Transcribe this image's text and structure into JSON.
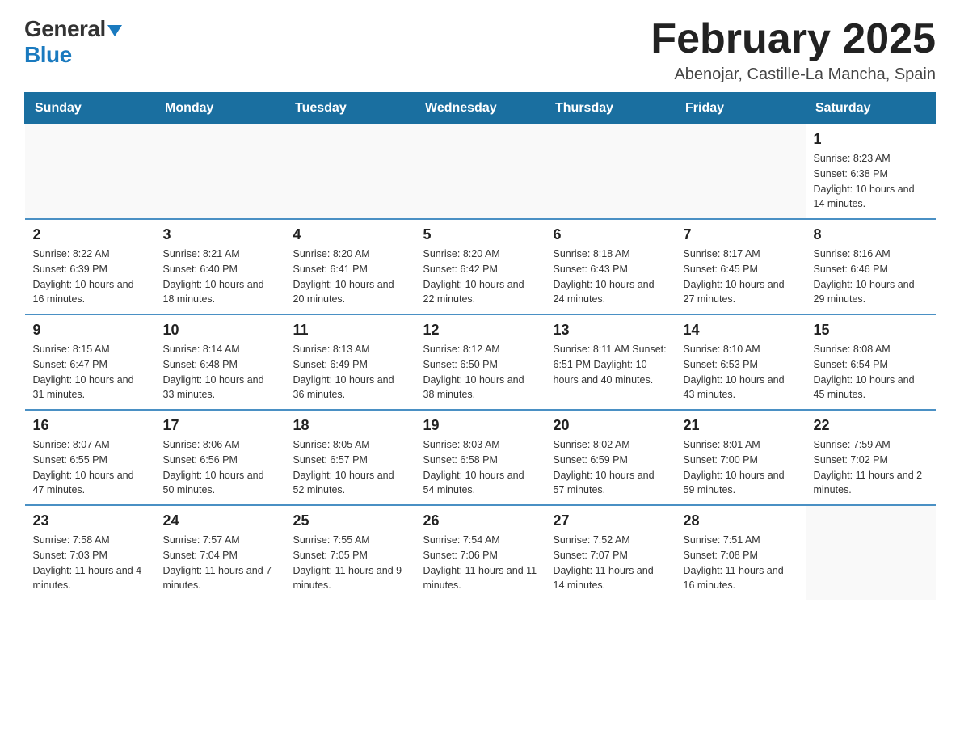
{
  "header": {
    "logo_general": "General",
    "logo_blue": "Blue",
    "title": "February 2025",
    "subtitle": "Abenojar, Castille-La Mancha, Spain"
  },
  "calendar": {
    "days_of_week": [
      "Sunday",
      "Monday",
      "Tuesday",
      "Wednesday",
      "Thursday",
      "Friday",
      "Saturday"
    ],
    "weeks": [
      [
        {
          "day": "",
          "info": ""
        },
        {
          "day": "",
          "info": ""
        },
        {
          "day": "",
          "info": ""
        },
        {
          "day": "",
          "info": ""
        },
        {
          "day": "",
          "info": ""
        },
        {
          "day": "",
          "info": ""
        },
        {
          "day": "1",
          "info": "Sunrise: 8:23 AM\nSunset: 6:38 PM\nDaylight: 10 hours and 14 minutes."
        }
      ],
      [
        {
          "day": "2",
          "info": "Sunrise: 8:22 AM\nSunset: 6:39 PM\nDaylight: 10 hours and 16 minutes."
        },
        {
          "day": "3",
          "info": "Sunrise: 8:21 AM\nSunset: 6:40 PM\nDaylight: 10 hours and 18 minutes."
        },
        {
          "day": "4",
          "info": "Sunrise: 8:20 AM\nSunset: 6:41 PM\nDaylight: 10 hours and 20 minutes."
        },
        {
          "day": "5",
          "info": "Sunrise: 8:20 AM\nSunset: 6:42 PM\nDaylight: 10 hours and 22 minutes."
        },
        {
          "day": "6",
          "info": "Sunrise: 8:18 AM\nSunset: 6:43 PM\nDaylight: 10 hours and 24 minutes."
        },
        {
          "day": "7",
          "info": "Sunrise: 8:17 AM\nSunset: 6:45 PM\nDaylight: 10 hours and 27 minutes."
        },
        {
          "day": "8",
          "info": "Sunrise: 8:16 AM\nSunset: 6:46 PM\nDaylight: 10 hours and 29 minutes."
        }
      ],
      [
        {
          "day": "9",
          "info": "Sunrise: 8:15 AM\nSunset: 6:47 PM\nDaylight: 10 hours and 31 minutes."
        },
        {
          "day": "10",
          "info": "Sunrise: 8:14 AM\nSunset: 6:48 PM\nDaylight: 10 hours and 33 minutes."
        },
        {
          "day": "11",
          "info": "Sunrise: 8:13 AM\nSunset: 6:49 PM\nDaylight: 10 hours and 36 minutes."
        },
        {
          "day": "12",
          "info": "Sunrise: 8:12 AM\nSunset: 6:50 PM\nDaylight: 10 hours and 38 minutes."
        },
        {
          "day": "13",
          "info": "Sunrise: 8:11 AM\nSunset: 6:51 PM\nDaylight: 10 hours and 40 minutes."
        },
        {
          "day": "14",
          "info": "Sunrise: 8:10 AM\nSunset: 6:53 PM\nDaylight: 10 hours and 43 minutes."
        },
        {
          "day": "15",
          "info": "Sunrise: 8:08 AM\nSunset: 6:54 PM\nDaylight: 10 hours and 45 minutes."
        }
      ],
      [
        {
          "day": "16",
          "info": "Sunrise: 8:07 AM\nSunset: 6:55 PM\nDaylight: 10 hours and 47 minutes."
        },
        {
          "day": "17",
          "info": "Sunrise: 8:06 AM\nSunset: 6:56 PM\nDaylight: 10 hours and 50 minutes."
        },
        {
          "day": "18",
          "info": "Sunrise: 8:05 AM\nSunset: 6:57 PM\nDaylight: 10 hours and 52 minutes."
        },
        {
          "day": "19",
          "info": "Sunrise: 8:03 AM\nSunset: 6:58 PM\nDaylight: 10 hours and 54 minutes."
        },
        {
          "day": "20",
          "info": "Sunrise: 8:02 AM\nSunset: 6:59 PM\nDaylight: 10 hours and 57 minutes."
        },
        {
          "day": "21",
          "info": "Sunrise: 8:01 AM\nSunset: 7:00 PM\nDaylight: 10 hours and 59 minutes."
        },
        {
          "day": "22",
          "info": "Sunrise: 7:59 AM\nSunset: 7:02 PM\nDaylight: 11 hours and 2 minutes."
        }
      ],
      [
        {
          "day": "23",
          "info": "Sunrise: 7:58 AM\nSunset: 7:03 PM\nDaylight: 11 hours and 4 minutes."
        },
        {
          "day": "24",
          "info": "Sunrise: 7:57 AM\nSunset: 7:04 PM\nDaylight: 11 hours and 7 minutes."
        },
        {
          "day": "25",
          "info": "Sunrise: 7:55 AM\nSunset: 7:05 PM\nDaylight: 11 hours and 9 minutes."
        },
        {
          "day": "26",
          "info": "Sunrise: 7:54 AM\nSunset: 7:06 PM\nDaylight: 11 hours and 11 minutes."
        },
        {
          "day": "27",
          "info": "Sunrise: 7:52 AM\nSunset: 7:07 PM\nDaylight: 11 hours and 14 minutes."
        },
        {
          "day": "28",
          "info": "Sunrise: 7:51 AM\nSunset: 7:08 PM\nDaylight: 11 hours and 16 minutes."
        },
        {
          "day": "",
          "info": ""
        }
      ]
    ]
  }
}
